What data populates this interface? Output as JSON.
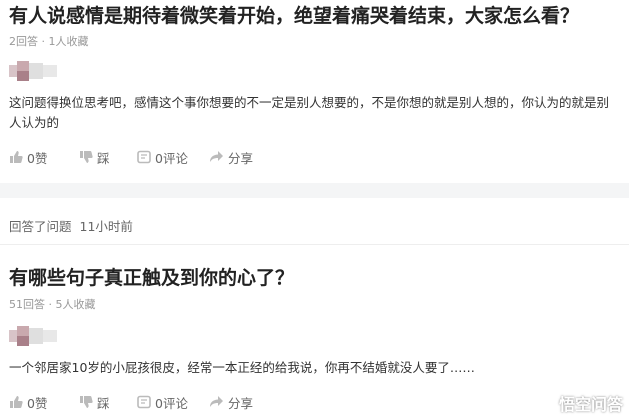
{
  "question1": {
    "title": "有人说感情是期待着微笑着开始，绝望着痛哭着结束，大家怎么看？",
    "meta": "2回答 · 1人收藏",
    "answer": "这问题得换位思考吧，感情这个事你想要的不一定是别人想要的，不是你想的就是别人想的，你认为的就是别人认为的",
    "actions": {
      "like": "0赞",
      "dislike": "踩",
      "comment": "0评论",
      "share": "分享"
    }
  },
  "activity": {
    "action": "回答了问题",
    "time": "11小时前"
  },
  "question2": {
    "title": "有哪些句子真正触及到你的心了？",
    "meta": "51回答 · 5人收藏",
    "answer": "一个邻居家10岁的小屁孩很皮，经常一本正经的给我说，你再不结婚就没人要了……",
    "actions": {
      "like": "0赞",
      "dislike": "踩",
      "comment": "0评论",
      "share": "分享"
    }
  },
  "watermark": "悟空问答",
  "icons": [
    "thumb-up-icon",
    "thumb-down-icon",
    "comment-icon",
    "share-icon"
  ],
  "colors": {
    "text": "#222222",
    "meta": "#999999",
    "icon": "#bbbbbb",
    "separator": "#f4f5f6"
  }
}
